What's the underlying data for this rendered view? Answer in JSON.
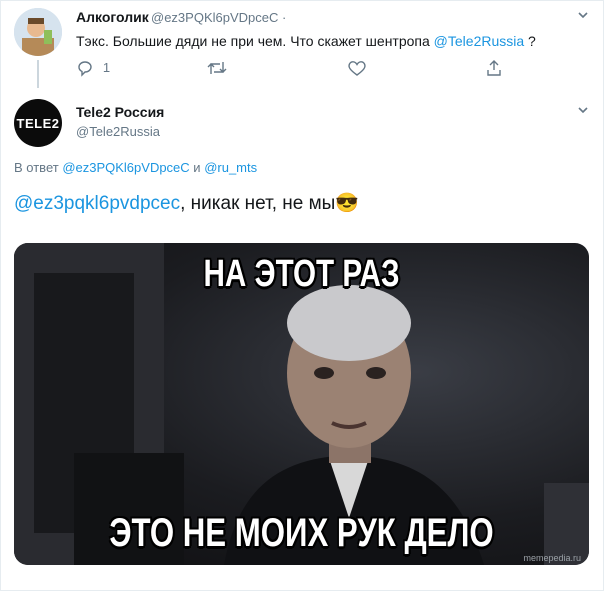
{
  "tweet1": {
    "name": "Алкоголик",
    "handle": "@ez3PQKl6pVDpceC",
    "text_before": "Тэкс. Большие дяди не при чем. Что скажет шентропа ",
    "mention": "@Tele2Russia",
    "text_after": " ?",
    "reply_count": "1"
  },
  "tweet2": {
    "name": "Tele2 Россия",
    "handle": "@Tele2Russia",
    "avatar_text": "TELE2",
    "reply_prefix": "В ответ ",
    "reply_user1": "@ez3PQKl6pVDpceC",
    "reply_and": " и ",
    "reply_user2": "@ru_mts",
    "mention": "@ez3pqkl6pvdpcec",
    "text": ", никак нет, не мы",
    "emoji": "😎"
  },
  "meme": {
    "top_text": "НА ЭТОТ РАЗ",
    "bottom_text": "ЭТО НЕ МОИХ РУК ДЕЛО",
    "watermark": "memepedia.ru"
  },
  "colors": {
    "link": "#1b95e0",
    "muted": "#657786"
  }
}
